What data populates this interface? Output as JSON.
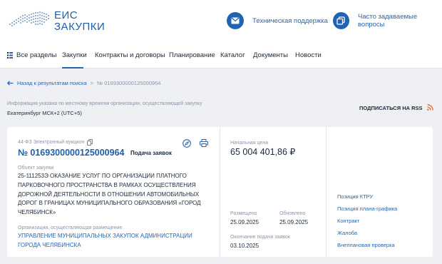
{
  "header": {
    "logo_line1": "ЕИС",
    "logo_line2": "ЗАКУПКИ",
    "support_label": "Техническая поддержка",
    "faq_label": "Часто задаваемые вопросы",
    "brand_color": "#1f5fa8"
  },
  "nav": {
    "items": [
      {
        "label": "Все разделы",
        "icon": "menu-icon"
      },
      {
        "label": "Закупки",
        "active": true
      },
      {
        "label": "Контракты и договоры"
      },
      {
        "label": "Планирование"
      },
      {
        "label": "Каталог"
      },
      {
        "label": "Документы"
      },
      {
        "label": "Новости"
      }
    ]
  },
  "breadcrumb": {
    "back_label": "Назад к результатам поиска",
    "separator": ">",
    "current": "№ 0169300000125000964"
  },
  "info_note": "Информация указана по местному времени организации, осуществляющей закупку",
  "timezone": "Екатеринбург МСК+2 (UTC+5)",
  "rss_label": "ПОДПИСАТЬСЯ НА RSS",
  "card": {
    "procurement_type": "44-ФЗ Электронный аукцион",
    "number": "№ 0169300000125000964",
    "status": "Подача заявок",
    "object_label": "Объект закупки",
    "object_text": "25-111253Э ОКАЗАНИЕ УСЛУГ ПО ОРГАНИЗАЦИИ ПЛАТНОГО ПАРКОВОЧНОГО ПРОСТРАНСТВА В РАМКАХ ОСУЩЕСТВЛЕНИЯ ДОРОЖНОЙ ДЕЯТЕЛЬНОСТИ В ОТНОШЕНИИ АВТОМОБИЛЬНЫХ ДОРОГ В ГРАНИЦАХ МУНИЦИПАЛЬНОГО ОБРАЗОВАНИЯ «ГОРОД ЧЕЛЯБИНСК»",
    "org_label": "Организация, осуществляющая размещение",
    "org_text": "УПРАВЛЕНИЕ МУНИЦИПАЛЬНЫХ ЗАКУПОК АДМИНИСТРАЦИИ ГОРОДА ЧЕЛЯБИНСКА",
    "price_label": "Начальная цена",
    "price": "65 004 401,86 ₽",
    "posted_label": "Размещено",
    "posted_date": "25.09.2025",
    "updated_label": "Обновлено",
    "updated_date": "25.09.2025",
    "deadline_label": "Окончание подачи заявок",
    "deadline_date": "03.10.2025",
    "links": [
      "Позиция КТРУ",
      "Позиция плана-графика",
      "Контракт",
      "Жалоба",
      "Внеплановая проверка"
    ]
  }
}
